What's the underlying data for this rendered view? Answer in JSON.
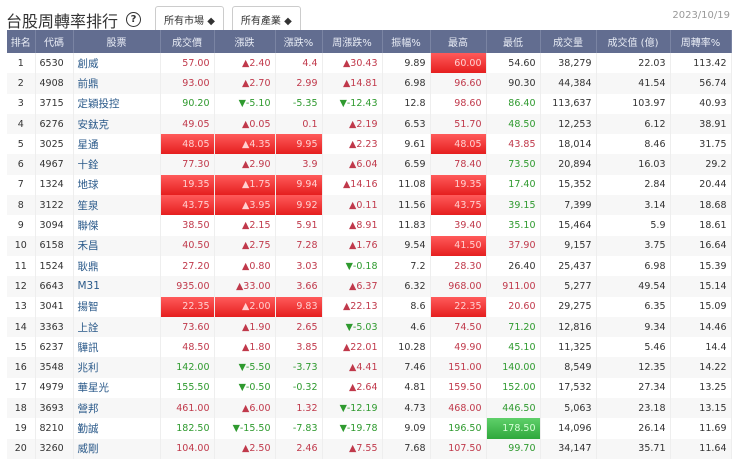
{
  "header": {
    "title": "台股周轉率排行",
    "help": "?",
    "market": "所有市場 ◆",
    "industry": "所有產業 ◆",
    "date": "2023/10/19"
  },
  "columns": [
    "排名",
    "代碼",
    "股票",
    "成交價",
    "漲跌",
    "漲跌%",
    "周漲跌%",
    "振幅%",
    "最高",
    "最低",
    "成交量",
    "成交值 (億)",
    "周轉率%"
  ],
  "rows": [
    [
      "1",
      "6530",
      "創威",
      "57.00",
      "▲2.40",
      "4.4",
      "▲30.43",
      "9.89",
      "60.00",
      "54.60",
      "38,279",
      "22.03",
      "113.42",
      "uuuuUn"
    ],
    [
      "2",
      "4908",
      "前鼎",
      "93.00",
      "▲2.70",
      "2.99",
      "▲14.81",
      "6.98",
      "96.60",
      "90.30",
      "44,384",
      "41.54",
      "56.74",
      "uuuuun"
    ],
    [
      "3",
      "3715",
      "定穎投控",
      "90.20",
      "▼-5.10",
      "-5.35",
      "▼-12.43",
      "12.8",
      "98.60",
      "86.40",
      "113,637",
      "103.97",
      "40.93",
      "ddddud"
    ],
    [
      "4",
      "6276",
      "安鈦克",
      "49.05",
      "▲0.05",
      "0.1",
      "▲2.19",
      "6.53",
      "51.70",
      "48.50",
      "12,253",
      "6.12",
      "38.91",
      "uuuuud"
    ],
    [
      "5",
      "3025",
      "星通",
      "48.05",
      "▲4.35",
      "9.95",
      "▲2.23",
      "9.61",
      "48.05",
      "43.85",
      "18,014",
      "8.46",
      "31.75",
      "UUUuUu"
    ],
    [
      "6",
      "4967",
      "十銓",
      "77.30",
      "▲2.90",
      "3.9",
      "▲6.04",
      "6.59",
      "78.40",
      "73.50",
      "20,894",
      "16.03",
      "29.2",
      "uuuuud"
    ],
    [
      "7",
      "1324",
      "地球",
      "19.35",
      "▲1.75",
      "9.94",
      "▲14.16",
      "11.08",
      "19.35",
      "17.40",
      "15,352",
      "2.84",
      "20.44",
      "UUUuUd"
    ],
    [
      "8",
      "3122",
      "笙泉",
      "43.75",
      "▲3.95",
      "9.92",
      "▲0.11",
      "11.56",
      "43.75",
      "39.15",
      "7,399",
      "3.14",
      "18.68",
      "UUUuUd"
    ],
    [
      "9",
      "3094",
      "聯傑",
      "38.50",
      "▲2.15",
      "5.91",
      "▲8.91",
      "11.83",
      "39.40",
      "35.10",
      "15,464",
      "5.9",
      "18.61",
      "uuuuud"
    ],
    [
      "10",
      "6158",
      "禾昌",
      "40.50",
      "▲2.75",
      "7.28",
      "▲1.76",
      "9.54",
      "41.50",
      "37.90",
      "9,157",
      "3.75",
      "16.64",
      "uuuuUu"
    ],
    [
      "11",
      "1524",
      "耿鼎",
      "27.20",
      "▲0.80",
      "3.03",
      "▼-0.18",
      "7.2",
      "28.30",
      "26.40",
      "25,437",
      "6.98",
      "15.39",
      "uuudun"
    ],
    [
      "12",
      "6643",
      "M31",
      "935.00",
      "▲33.00",
      "3.66",
      "▲6.37",
      "6.32",
      "968.00",
      "911.00",
      "5,277",
      "49.54",
      "15.14",
      "uuuuuu"
    ],
    [
      "13",
      "3041",
      "揚智",
      "22.35",
      "▲2.00",
      "9.83",
      "▲22.13",
      "8.6",
      "22.35",
      "20.60",
      "29,275",
      "6.35",
      "15.09",
      "UUUuUu"
    ],
    [
      "14",
      "3363",
      "上詮",
      "73.60",
      "▲1.90",
      "2.65",
      "▼-5.03",
      "4.6",
      "74.50",
      "71.20",
      "12,816",
      "9.34",
      "14.46",
      "uuudud"
    ],
    [
      "15",
      "6237",
      "驊訊",
      "48.50",
      "▲1.80",
      "3.85",
      "▲22.01",
      "10.28",
      "49.90",
      "45.10",
      "11,325",
      "5.46",
      "14.4",
      "uuuuud"
    ],
    [
      "16",
      "3548",
      "兆利",
      "142.00",
      "▼-5.50",
      "-3.73",
      "▲4.41",
      "7.46",
      "151.00",
      "140.00",
      "8,549",
      "12.35",
      "14.22",
      "ddduud"
    ],
    [
      "17",
      "4979",
      "華星光",
      "155.50",
      "▼-0.50",
      "-0.32",
      "▲2.64",
      "4.81",
      "159.50",
      "152.00",
      "17,532",
      "27.34",
      "13.25",
      "ddduud"
    ],
    [
      "18",
      "3693",
      "營邦",
      "461.00",
      "▲6.00",
      "1.32",
      "▼-12.19",
      "4.73",
      "468.00",
      "446.50",
      "5,063",
      "23.18",
      "13.15",
      "uuudud"
    ],
    [
      "19",
      "8210",
      "勤誠",
      "182.50",
      "▼-15.50",
      "-7.83",
      "▼-19.78",
      "9.09",
      "196.50",
      "178.50",
      "14,096",
      "26.14",
      "11.69",
      "ddddde"
    ],
    [
      "20",
      "3260",
      "威剛",
      "104.00",
      "▲2.50",
      "2.46",
      "▲7.55",
      "7.68",
      "107.50",
      "99.70",
      "34,147",
      "35.71",
      "11.64",
      "uuuuud"
    ]
  ]
}
